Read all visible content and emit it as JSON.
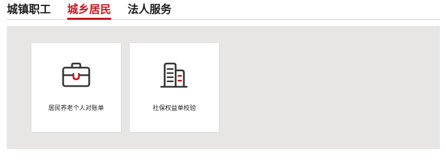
{
  "tabs": [
    {
      "label": "城镇职工",
      "active": false
    },
    {
      "label": "城乡居民",
      "active": true
    },
    {
      "label": "法人服务",
      "active": false
    }
  ],
  "cards": [
    {
      "label": "居民养老个人对账单",
      "icon": "briefcase-icon"
    },
    {
      "label": "社保权益单校验",
      "icon": "buildings-icon"
    }
  ],
  "colors": {
    "accent": "#c7161e",
    "panel_bg": "#e7e6e4",
    "icon_stroke": "#333333"
  }
}
